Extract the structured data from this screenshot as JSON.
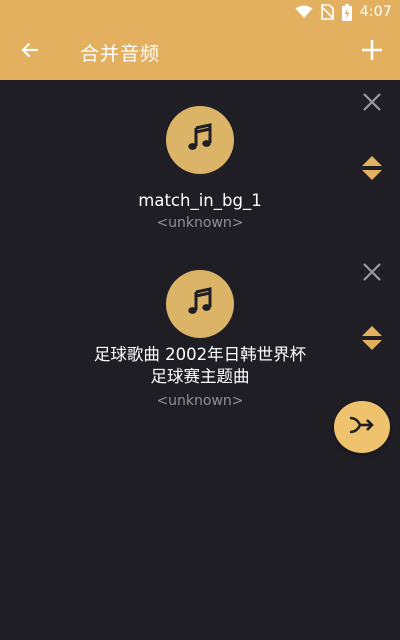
{
  "status_bar": {
    "time": "4:07",
    "icons": [
      "wifi-icon",
      "no-sim-icon",
      "battery-charging-icon"
    ]
  },
  "app_bar": {
    "title": "合并音频",
    "back_icon": "arrow-left-icon",
    "add_icon": "plus-icon",
    "background_color": "#e2b05f"
  },
  "tracks": [
    {
      "name": "match_in_bg_1",
      "artist": "<unknown>",
      "icon": "music-note-icon",
      "remove_icon": "close-icon",
      "reorder_icon": "reorder-icon"
    },
    {
      "name_line1": "足球歌曲 2002年日韩世界杯",
      "name_line2": "足球赛主题曲",
      "artist": "<unknown>",
      "icon": "music-note-icon",
      "remove_icon": "close-icon",
      "reorder_icon": "reorder-icon"
    }
  ],
  "fab": {
    "icon": "merge-icon"
  },
  "colors": {
    "accent": "#e2b05f",
    "background": "#1f1e24",
    "secondary_text": "#8f8f95",
    "icon_gray": "#9a9aa0"
  }
}
